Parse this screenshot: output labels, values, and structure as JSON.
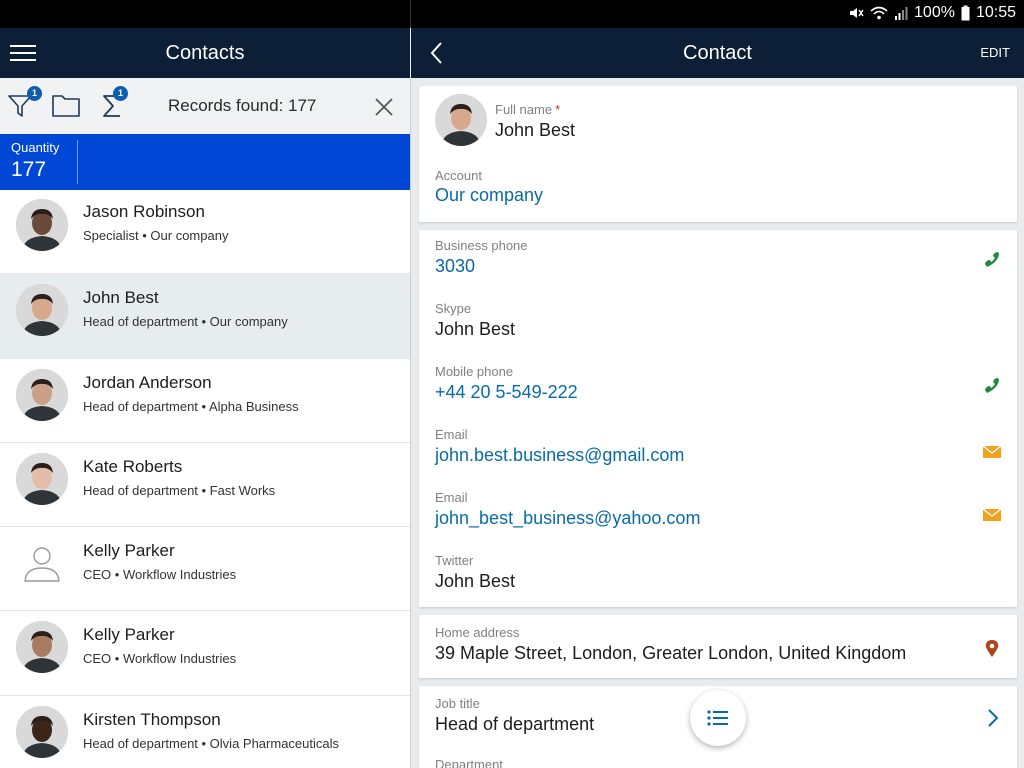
{
  "status_bar": {
    "battery": "100%",
    "time": "10:55"
  },
  "left_header": {
    "title": "Contacts"
  },
  "right_header": {
    "title": "Contact",
    "edit_label": "EDIT"
  },
  "toolbar": {
    "filter_badge": "1",
    "sum_badge": "1",
    "records_found": "Records found: 177"
  },
  "summary": {
    "label": "Quantity",
    "value": "177"
  },
  "contacts": [
    {
      "name": "Jason Robinson",
      "subtitle": "Specialist • Our company",
      "avatar": "photo",
      "skin": "#6b4a3a"
    },
    {
      "name": "John Best",
      "subtitle": "Head of department • Our company",
      "avatar": "photo",
      "skin": "#d7a88c"
    },
    {
      "name": "Jordan Anderson",
      "subtitle": "Head of department • Alpha Business",
      "avatar": "photo",
      "skin": "#caa08a"
    },
    {
      "name": "Kate Roberts",
      "subtitle": "Head of department • Fast Works",
      "avatar": "photo",
      "skin": "#e3bda8"
    },
    {
      "name": "Kelly Parker",
      "subtitle": "CEO • Workflow Industries",
      "avatar": "placeholder",
      "skin": "#ffffff"
    },
    {
      "name": "Kelly Parker",
      "subtitle": "CEO • Workflow Industries",
      "avatar": "photo",
      "skin": "#a87a5f"
    },
    {
      "name": "Kirsten Thompson",
      "subtitle": "Head of department • Olvia Pharmaceuticals",
      "avatar": "photo",
      "skin": "#3b2418"
    }
  ],
  "contact": {
    "full_name_label": "Full name",
    "full_name_required": "*",
    "full_name": "John Best",
    "account_label": "Account",
    "account": "Our company",
    "business_phone_label": "Business phone",
    "business_phone": "3030",
    "skype_label": "Skype",
    "skype": "John Best",
    "mobile_phone_label": "Mobile phone",
    "mobile_phone": "+44 20 5-549-222",
    "email1_label": "Email",
    "email1": "john.best.business@gmail.com",
    "email2_label": "Email",
    "email2": "john_best_business@yahoo.com",
    "twitter_label": "Twitter",
    "twitter": "John Best",
    "home_address_label": "Home address",
    "home_address": "39 Maple Street, London, Greater London, United Kingdom",
    "job_title_label": "Job title",
    "job_title": "Head of department",
    "department_label": "Department"
  },
  "colors": {
    "app_bar": "#0c1f37",
    "summary_bar": "#0047d6",
    "link": "#0a6aa8",
    "phone_icon": "#1e8a3c",
    "email_icon": "#f0a21a",
    "location_icon": "#b0421c"
  }
}
